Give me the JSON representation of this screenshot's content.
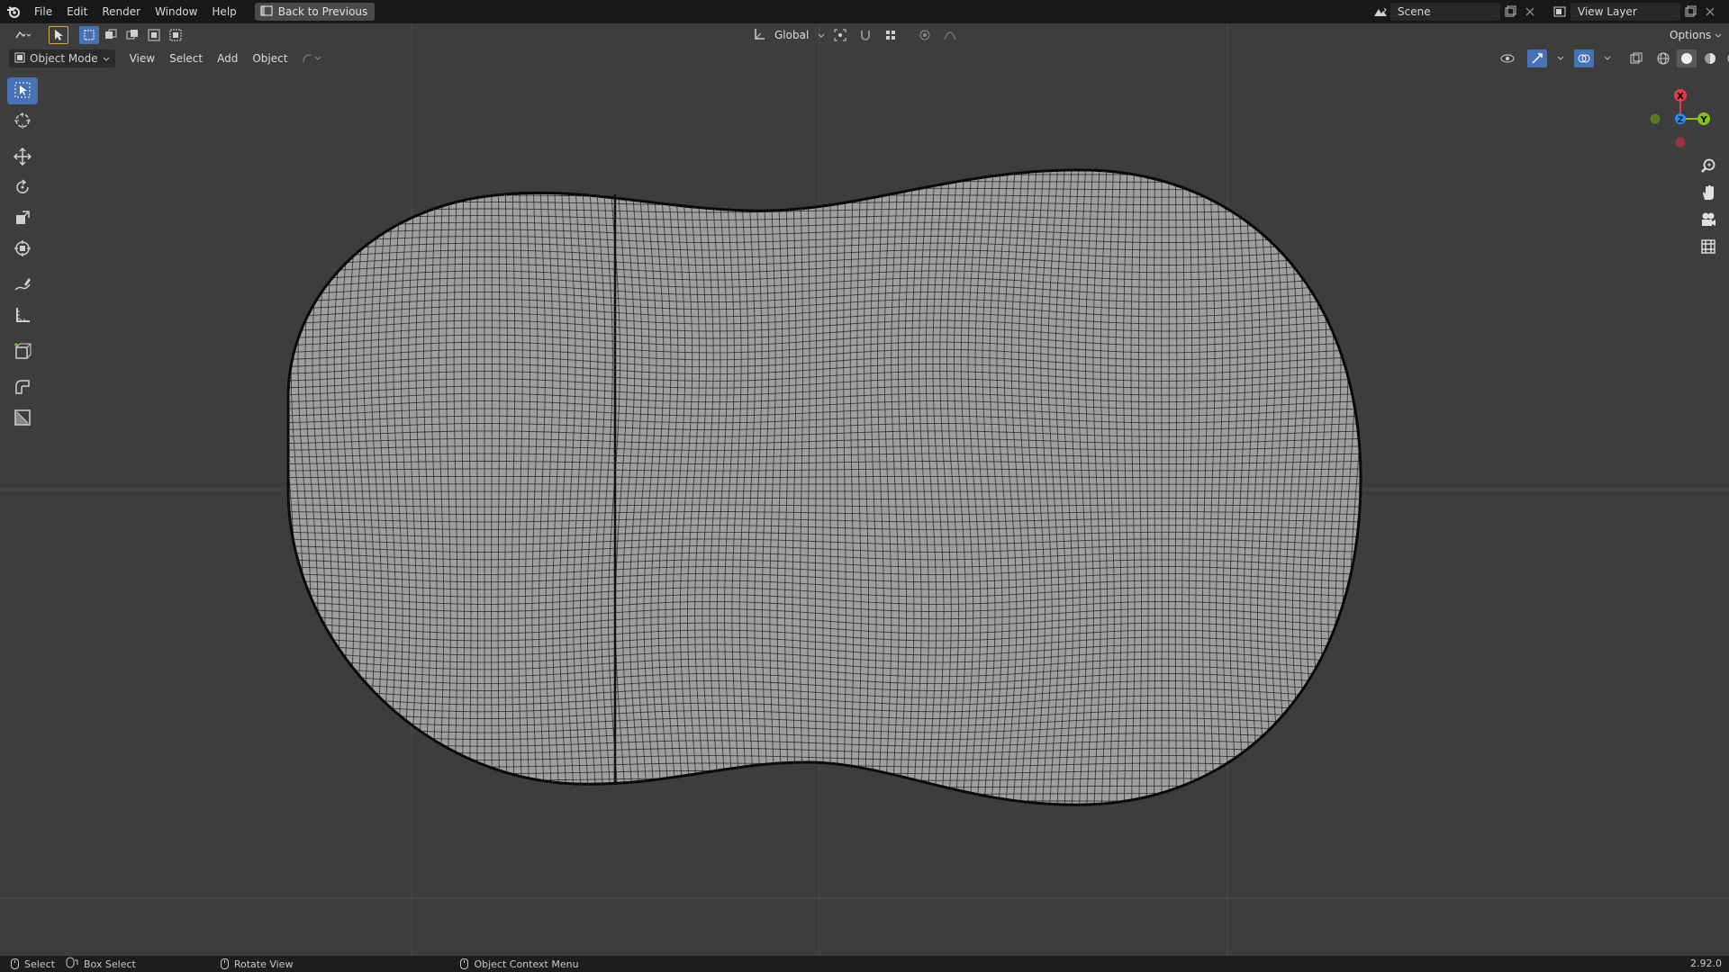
{
  "menu": {
    "items": [
      "File",
      "Edit",
      "Render",
      "Window",
      "Help"
    ],
    "back_button": "Back to Previous"
  },
  "scene": {
    "name": "Scene"
  },
  "view_layer": {
    "name": "View Layer"
  },
  "viewport_header": {
    "orientation": "Global",
    "options": "Options",
    "mode": "Object Mode",
    "menus": [
      "View",
      "Select",
      "Add",
      "Object"
    ]
  },
  "gizmo": {
    "x": "X",
    "y": "Y",
    "z": "Z"
  },
  "status_bar": {
    "select": "Select",
    "box_select": "Box Select",
    "rotate_view": "Rotate View",
    "context_menu": "Object Context Menu",
    "version": "2.92.0"
  },
  "colors": {
    "accent": "#4772b3",
    "viewport_bg": "#3d3d3d",
    "mesh_fill": "#a0a0a0",
    "axis_x": "#e2384b",
    "axis_y": "#84c21b",
    "axis_z": "#2d8ceb"
  },
  "icons": [
    "blender-logo",
    "select-box",
    "cursor",
    "move",
    "rotate",
    "scale",
    "transform",
    "annotate",
    "measure",
    "add-cube",
    "extrude",
    "bevel",
    "zoom",
    "hand",
    "camera",
    "grid"
  ]
}
